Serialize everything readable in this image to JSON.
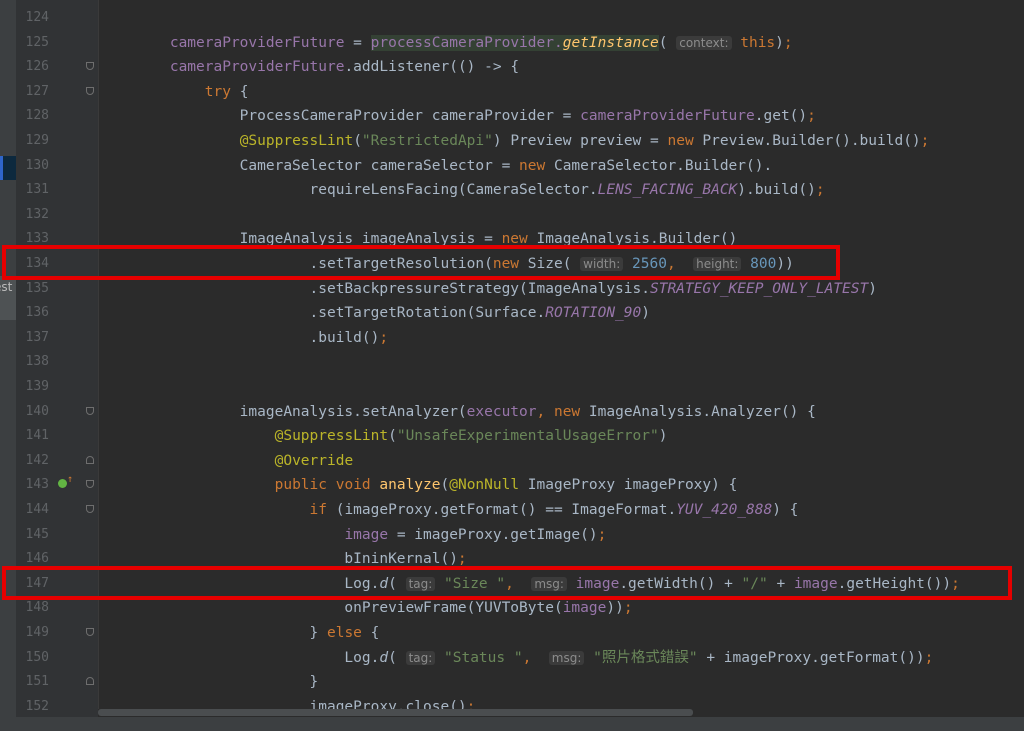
{
  "sidebar": {
    "tab_label": "est"
  },
  "lines": [
    {
      "num": "124",
      "code": ""
    },
    {
      "num": "125",
      "code": "        cameraProviderFuture = processCameraProvider.getInstance( context: this);"
    },
    {
      "num": "126",
      "code": "        cameraProviderFuture.addListener(() -> {"
    },
    {
      "num": "127",
      "code": "            try {"
    },
    {
      "num": "128",
      "code": "                ProcessCameraProvider cameraProvider = cameraProviderFuture.get();"
    },
    {
      "num": "129",
      "code": "                @SuppressLint(\"RestrictedApi\") Preview preview = new Preview.Builder().build();"
    },
    {
      "num": "130",
      "code": "                CameraSelector cameraSelector = new CameraSelector.Builder()."
    },
    {
      "num": "131",
      "code": "                        requireLensFacing(CameraSelector.LENS_FACING_BACK).build();"
    },
    {
      "num": "132",
      "code": ""
    },
    {
      "num": "133",
      "code": "                ImageAnalysis imageAnalysis = new ImageAnalysis.Builder()"
    },
    {
      "num": "134",
      "code": "                        .setTargetResolution(new Size( width: 2560,  height: 800))"
    },
    {
      "num": "135",
      "code": "                        .setBackpressureStrategy(ImageAnalysis.STRATEGY_KEEP_ONLY_LATEST)"
    },
    {
      "num": "136",
      "code": "                        .setTargetRotation(Surface.ROTATION_90)"
    },
    {
      "num": "137",
      "code": "                        .build();"
    },
    {
      "num": "138",
      "code": ""
    },
    {
      "num": "139",
      "code": ""
    },
    {
      "num": "140",
      "code": "                imageAnalysis.setAnalyzer(executor, new ImageAnalysis.Analyzer() {"
    },
    {
      "num": "141",
      "code": "                    @SuppressLint(\"UnsafeExperimentalUsageError\")"
    },
    {
      "num": "142",
      "code": "                    @Override"
    },
    {
      "num": "143",
      "code": "                    public void analyze(@NonNull ImageProxy imageProxy) {"
    },
    {
      "num": "144",
      "code": "                        if (imageProxy.getFormat() == ImageFormat.YUV_420_888) {"
    },
    {
      "num": "145",
      "code": "                            image = imageProxy.getImage();"
    },
    {
      "num": "146",
      "code": "                            bIninKernal();"
    },
    {
      "num": "147",
      "code": "                            Log.d( tag: \"Size \",  msg: image.getWidth() + \"/\" + image.getHeight());"
    },
    {
      "num": "148",
      "code": "                            onPreviewFrame(YUVToByte(image));"
    },
    {
      "num": "149",
      "code": "                        } else {"
    },
    {
      "num": "150",
      "code": "                            Log.d( tag: \"Status \",  msg: \"照片格式錯誤\" + imageProxy.getFormat());"
    },
    {
      "num": "151",
      "code": "                        }"
    },
    {
      "num": "152",
      "code": "                        imageProxy.close();"
    }
  ],
  "colors": {
    "background": "#2b2b2b",
    "keyword": "#cc7832",
    "string": "#6a8759",
    "number": "#6897bb",
    "field": "#9876aa",
    "annotation": "#bbb529",
    "method_decl": "#ffc66d",
    "highlight_box": "#e60000"
  }
}
